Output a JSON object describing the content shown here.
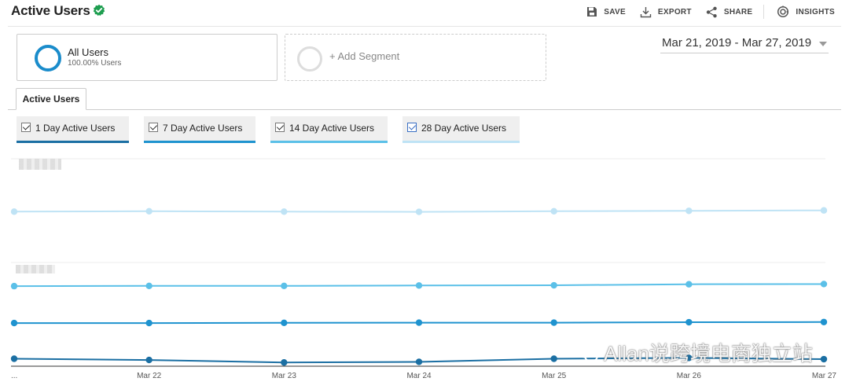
{
  "header": {
    "title": "Active Users",
    "tools": {
      "save": "SAVE",
      "export": "EXPORT",
      "share": "SHARE",
      "insights": "INSIGHTS"
    }
  },
  "segments": {
    "active": {
      "name": "All Users",
      "sub": "100.00% Users"
    },
    "add_label": "+ Add Segment"
  },
  "date_range": "Mar 21, 2019 - Mar 27, 2019",
  "tab": "Active Users",
  "metrics": [
    {
      "label": "1 Day Active Users",
      "color": "#1b6fa3",
      "checked": true
    },
    {
      "label": "7 Day Active Users",
      "color": "#1f93cf",
      "checked": true
    },
    {
      "label": "14 Day Active Users",
      "color": "#5bc0e8",
      "checked": true
    },
    {
      "label": "28 Day Active Users",
      "color": "#bfe3f5",
      "checked": true
    }
  ],
  "chart_data": {
    "type": "line",
    "x": [
      "...",
      "Mar 22",
      "Mar 23",
      "Mar 24",
      "Mar 25",
      "Mar 26",
      "Mar 27"
    ],
    "ylim": [
      0,
      100
    ],
    "grid": true,
    "series": [
      {
        "name": "28 Day Active Users",
        "color": "#bfe3f5",
        "values": [
          74.5,
          74.7,
          74.5,
          74.4,
          74.7,
          74.9,
          75.1
        ]
      },
      {
        "name": "14 Day Active Users",
        "color": "#5bc0e8",
        "values": [
          38.6,
          38.7,
          38.7,
          38.9,
          39.0,
          39.5,
          39.6
        ]
      },
      {
        "name": "7 Day Active Users",
        "color": "#1f93cf",
        "values": [
          20.8,
          20.8,
          20.9,
          21.0,
          21.0,
          21.2,
          21.3
        ]
      },
      {
        "name": "1 Day Active Users",
        "color": "#1b6fa3",
        "values": [
          3.6,
          3.0,
          1.8,
          2.1,
          3.6,
          4.0,
          3.4
        ]
      }
    ]
  },
  "watermark": "Allan说跨境电商独立站"
}
